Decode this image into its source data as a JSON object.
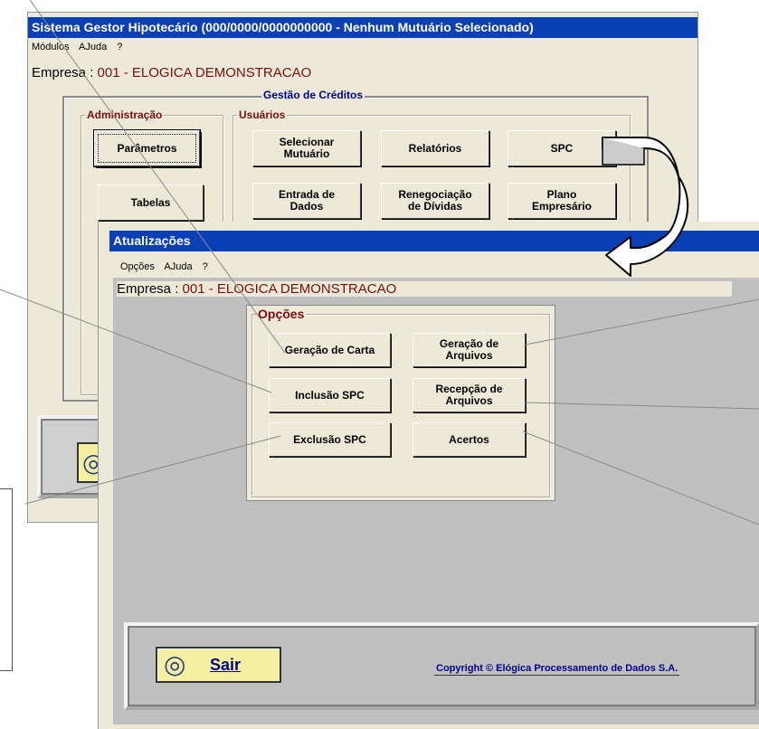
{
  "main_window": {
    "title": "Sistema Gestor Hipotecário (000/0000/0000000000 - Nenhum Mutuário Selecionado)",
    "menu": [
      "Módulos",
      "AJuda",
      "?"
    ],
    "empresa_label": "Empresa :",
    "empresa_value": "001 - ELOGICA DEMONSTRACAO",
    "group_title": "Gestão de Créditos",
    "admin_title": "Administração",
    "users_title": "Usuários",
    "admin_buttons": [
      "Parâmetros",
      "Tabelas"
    ],
    "user_buttons": [
      "Selecionar\nMutuário",
      "Relatórios",
      "SPC",
      "Entrada de\nDados",
      "Renegociação\nde Dívidas",
      "Plano\nEmpresário"
    ],
    "sair_icon_glyph": "◎"
  },
  "sub_window": {
    "title": "Atualizações",
    "menu": [
      "Opções",
      "AJuda",
      "?"
    ],
    "empresa_label": "Empresa :",
    "empresa_value": "001 - ELOGICA DEMONSTRACAO",
    "options_title": "Opções",
    "buttons": [
      "Geração de Carta",
      "Geração de\nArquivos",
      "Inclusão SPC",
      "Recepção de\nArquivos",
      "Exclusão SPC",
      "Acertos"
    ],
    "sair_label": "Sair",
    "sair_icon_glyph": "◎",
    "copyright": "Copyright © Elógica Processamento de Dados S.A."
  },
  "colors": {
    "title_bar": "#0a3fb6",
    "empresa_value": "#7a0f0f",
    "group_label": "#7a0f0f",
    "window_bg": "#ece9d8",
    "sub_body_bg": "#c0c0c0"
  },
  "icons": [
    "curved-arrow-icon",
    "sair-icon"
  ]
}
